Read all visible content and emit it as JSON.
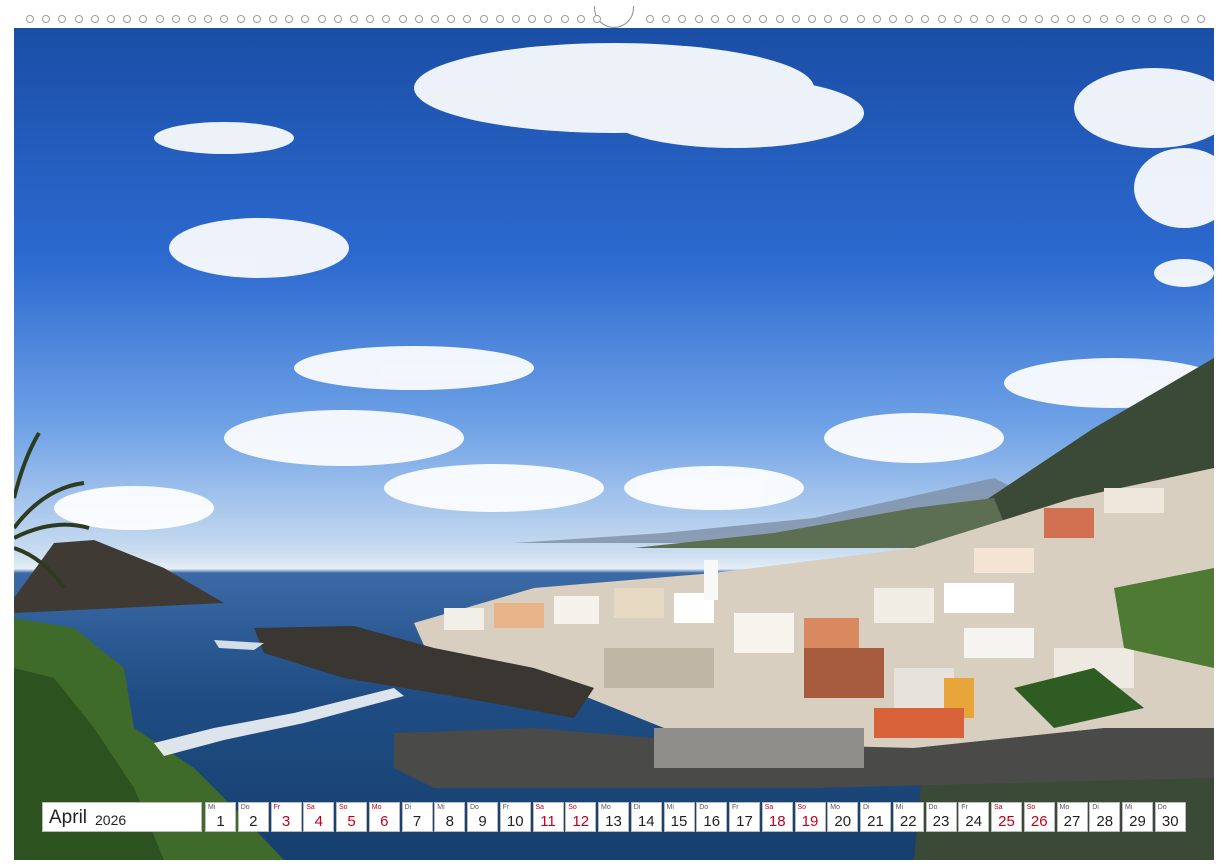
{
  "calendar": {
    "month": "April",
    "year": "2026",
    "days": [
      {
        "dow": "Mi",
        "num": "1",
        "red": false
      },
      {
        "dow": "Do",
        "num": "2",
        "red": false
      },
      {
        "dow": "Fr",
        "num": "3",
        "red": true
      },
      {
        "dow": "Sa",
        "num": "4",
        "red": true
      },
      {
        "dow": "So",
        "num": "5",
        "red": true
      },
      {
        "dow": "Mo",
        "num": "6",
        "red": true
      },
      {
        "dow": "Di",
        "num": "7",
        "red": false
      },
      {
        "dow": "Mi",
        "num": "8",
        "red": false
      },
      {
        "dow": "Do",
        "num": "9",
        "red": false
      },
      {
        "dow": "Fr",
        "num": "10",
        "red": false
      },
      {
        "dow": "Sa",
        "num": "11",
        "red": true
      },
      {
        "dow": "So",
        "num": "12",
        "red": true
      },
      {
        "dow": "Mo",
        "num": "13",
        "red": false
      },
      {
        "dow": "Di",
        "num": "14",
        "red": false
      },
      {
        "dow": "Mi",
        "num": "15",
        "red": false
      },
      {
        "dow": "Do",
        "num": "16",
        "red": false
      },
      {
        "dow": "Fr",
        "num": "17",
        "red": false
      },
      {
        "dow": "Sa",
        "num": "18",
        "red": true
      },
      {
        "dow": "So",
        "num": "19",
        "red": true
      },
      {
        "dow": "Mo",
        "num": "20",
        "red": false
      },
      {
        "dow": "Di",
        "num": "21",
        "red": false
      },
      {
        "dow": "Mi",
        "num": "22",
        "red": false
      },
      {
        "dow": "Do",
        "num": "23",
        "red": false
      },
      {
        "dow": "Fr",
        "num": "24",
        "red": false
      },
      {
        "dow": "Sa",
        "num": "25",
        "red": true
      },
      {
        "dow": "So",
        "num": "26",
        "red": true
      },
      {
        "dow": "Mo",
        "num": "27",
        "red": false
      },
      {
        "dow": "Di",
        "num": "28",
        "red": false
      },
      {
        "dow": "Mi",
        "num": "29",
        "red": false
      },
      {
        "dow": "Do",
        "num": "30",
        "red": false
      }
    ]
  },
  "colors": {
    "holiday_red": "#c0001a",
    "sky_blue": "#2c6ad0",
    "sea_blue": "#1f4d84"
  }
}
